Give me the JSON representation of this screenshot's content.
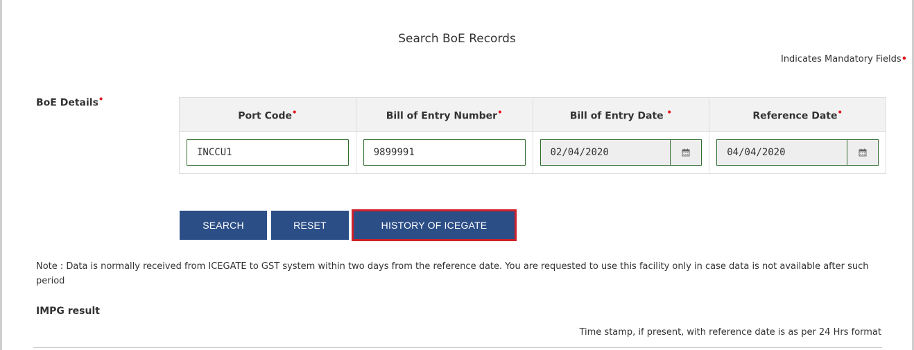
{
  "page_title": "Search BoE Records",
  "mandatory_note": "Indicates Mandatory Fields",
  "required_marker": "•",
  "boe_section_label": "BoE Details",
  "columns": [
    {
      "header": "Port Code"
    },
    {
      "header": "Bill of Entry Number"
    },
    {
      "header": "Bill of Entry Date "
    },
    {
      "header": "Reference Date"
    }
  ],
  "fields": {
    "port_code": "INCCU1",
    "boe_number": "9899991",
    "boe_date": "02/04/2020",
    "reference_date": "04/04/2020"
  },
  "buttons": {
    "search": "SEARCH",
    "reset": "RESET",
    "history": "HISTORY OF ICEGATE"
  },
  "note": "Note : Data is normally received from ICEGATE to GST system within two days from the reference date. You are requested to use this facility only in case data is not available after such period",
  "impg_label": "IMPG result",
  "timestamp_note": "Time stamp, if present, with reference date is as per 24 Hrs format",
  "icons": {
    "calendar": "calendar-icon"
  },
  "colors": {
    "button_bg": "#2c4e86",
    "highlight_border": "#d0202a",
    "required": "#e2131a",
    "input_border": "#2f6b2f"
  }
}
